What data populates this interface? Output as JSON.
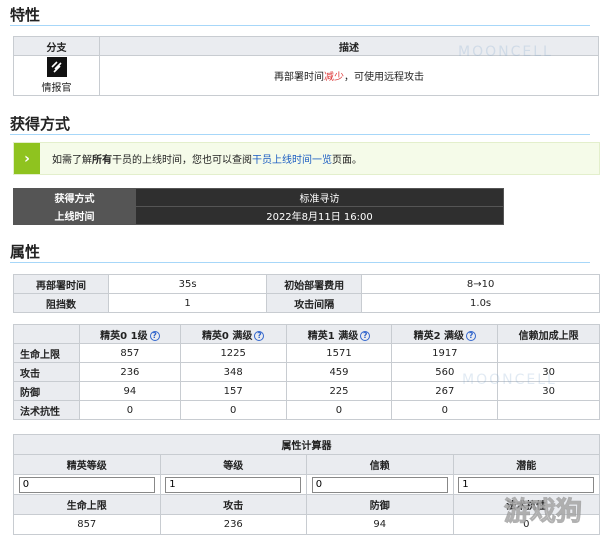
{
  "sections": {
    "traits": "特性",
    "obtain": "获得方式",
    "attributes": "属性"
  },
  "trait": {
    "header_branch": "分支",
    "header_desc": "描述",
    "branch_name": "情报官",
    "desc_before": "再部署时间",
    "desc_highlight": "减少",
    "desc_after": "，可使用远程攻击"
  },
  "tip": {
    "before": "如需了解",
    "bold": "所有",
    "middle": "干员的上线时间，您也可以查阅",
    "link": "干员上线时间一览",
    "after": "页面。"
  },
  "obtain": {
    "method_label": "获得方式",
    "method_value": "标准寻访",
    "online_label": "上线时间",
    "online_value": "2022年8月11日 16:00"
  },
  "attr": {
    "redeploy_label": "再部署时间",
    "redeploy_value": "35s",
    "cost_label": "初始部署费用",
    "cost_value": "8→10",
    "block_label": "阻挡数",
    "block_value": "1",
    "interval_label": "攻击间隔",
    "interval_value": "1.0s"
  },
  "stats": {
    "headers": [
      "精英0 1级",
      "精英0 满级",
      "精英1 满级",
      "精英2 满级",
      "信赖加成上限"
    ],
    "rows": [
      {
        "label": "生命上限",
        "values": [
          "857",
          "1225",
          "1571",
          "1917",
          ""
        ]
      },
      {
        "label": "攻击",
        "values": [
          "236",
          "348",
          "459",
          "560",
          "30"
        ]
      },
      {
        "label": "防御",
        "values": [
          "94",
          "157",
          "225",
          "267",
          "30"
        ]
      },
      {
        "label": "法术抗性",
        "values": [
          "0",
          "0",
          "0",
          "0",
          ""
        ]
      }
    ]
  },
  "calc": {
    "title": "属性计算器",
    "labels": [
      "精英等级",
      "等级",
      "信赖",
      "潜能"
    ],
    "inputs": [
      "0",
      "1",
      "0",
      "1"
    ],
    "result_labels": [
      "生命上限",
      "攻击",
      "防御",
      "法术抗性"
    ],
    "result_values": [
      "857",
      "236",
      "94",
      "0"
    ]
  },
  "watermark": "MOONCELL",
  "logo_text": "游戏狗"
}
